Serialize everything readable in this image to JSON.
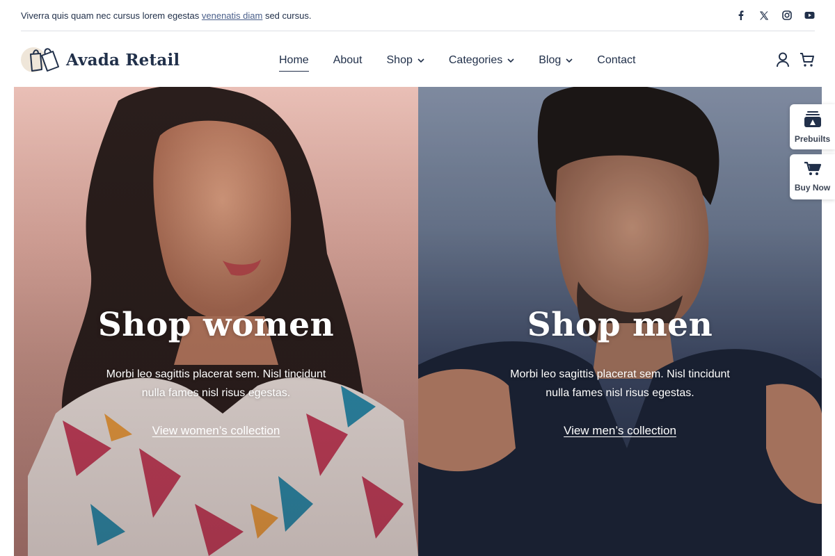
{
  "topbar": {
    "text_before": "Viverra quis quam nec cursus lorem egestas ",
    "link": "venenatis diam",
    "text_after": " sed cursus.",
    "social_icons": [
      "facebook-icon",
      "x-icon",
      "instagram-icon",
      "youtube-icon"
    ]
  },
  "header": {
    "logo_text": "Avada Retail",
    "nav": [
      {
        "label": "Home",
        "active": true,
        "dropdown": false
      },
      {
        "label": "About",
        "active": false,
        "dropdown": false
      },
      {
        "label": "Shop",
        "active": false,
        "dropdown": true
      },
      {
        "label": "Categories",
        "active": false,
        "dropdown": true
      },
      {
        "label": "Blog",
        "active": false,
        "dropdown": true
      },
      {
        "label": "Contact",
        "active": false,
        "dropdown": false
      }
    ],
    "right_icons": [
      "user-icon",
      "cart-icon"
    ]
  },
  "hero": {
    "women": {
      "title": "Shop women",
      "description": "Morbi leo sagittis placerat sem. Nisl tincidunt nulla fames nisl risus egestas.",
      "link": "View women’s collection"
    },
    "men": {
      "title": "Shop men",
      "description": "Morbi leo sagittis placerat sem. Nisl tincidunt nulla fames nisl risus egestas.",
      "link": "View men’s collection"
    }
  },
  "side_widgets": {
    "prebuilts": "Prebuilts",
    "buy_now": "Buy Now"
  },
  "colors": {
    "brand_navy": "#21304a",
    "link_blue": "#4a5f8a",
    "logo_blob": "#efe6d9"
  }
}
